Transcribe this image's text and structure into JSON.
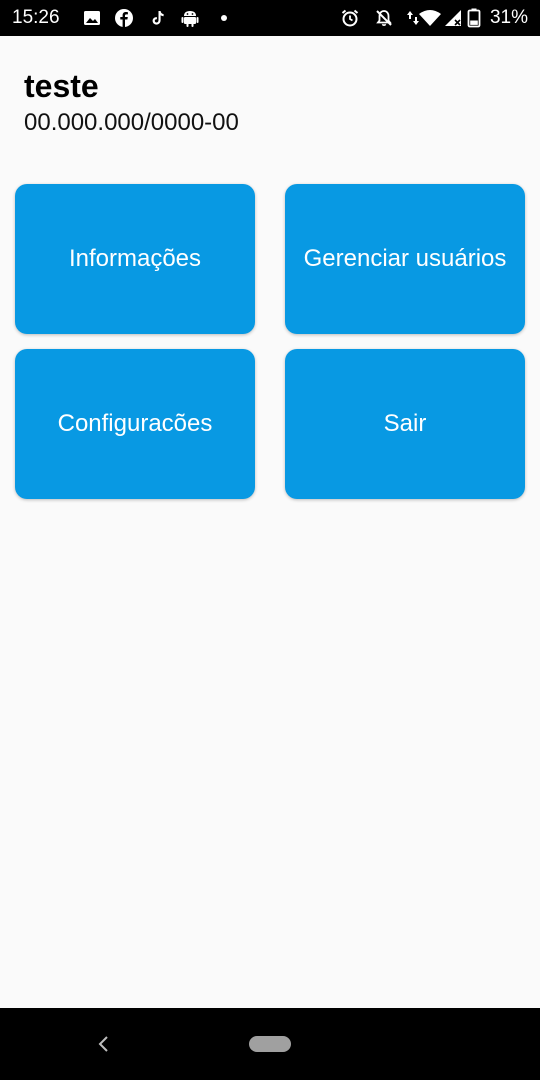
{
  "status_bar": {
    "time": "15:26",
    "battery_percent": "31%",
    "left_icons": [
      "image-icon",
      "facebook-icon",
      "tiktok-icon",
      "android-icon",
      "dot-icon"
    ],
    "right_icons": [
      "alarm-icon",
      "bell-off-icon",
      "data-arrows-icon",
      "wifi-icon",
      "signal-icon",
      "battery-icon"
    ]
  },
  "header": {
    "company_name": "teste",
    "company_id": "00.000.000/0000-00"
  },
  "menu": {
    "info_label": "Informações",
    "users_label": "Gerenciar usuários",
    "settings_label": "Configuracões",
    "exit_label": "Sair"
  },
  "colors": {
    "button_bg": "#0899e3",
    "button_text": "#ffffff",
    "page_bg": "#fafafa"
  }
}
